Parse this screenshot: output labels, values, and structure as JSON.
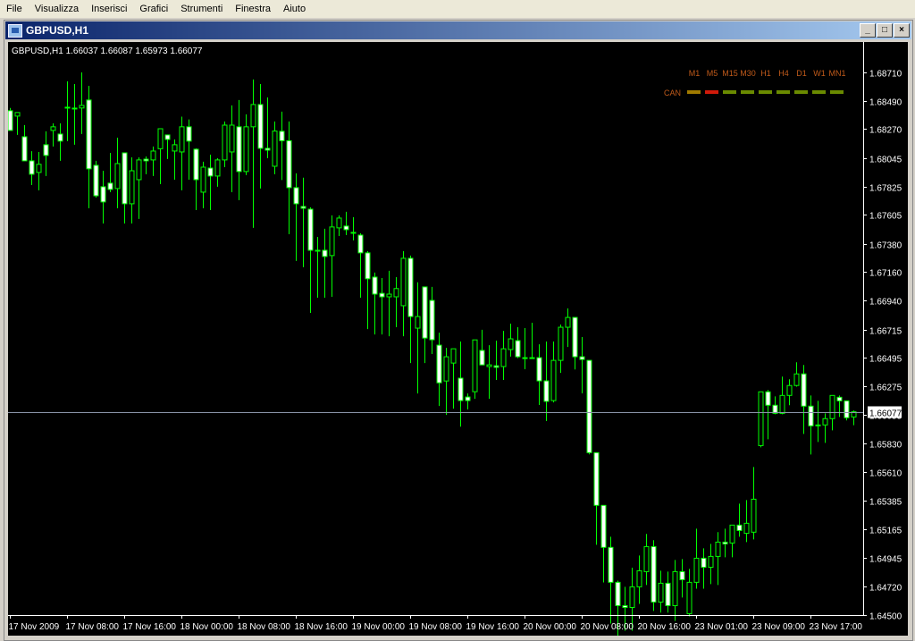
{
  "menu": [
    "File",
    "Visualizza",
    "Inserisci",
    "Grafici",
    "Strumenti",
    "Finestra",
    "Aiuto"
  ],
  "window": {
    "title": "GBPUSD,H1",
    "buttons": {
      "minimize": "_",
      "maximize": "□",
      "close": "×"
    }
  },
  "colors": {
    "background": "#000000",
    "candle_outline": "#00ff00",
    "bear_fill": "#ffffff",
    "bull_fill": "#000000",
    "axis": "#ffffff",
    "bid_line": "#8a94a8",
    "indicator_text": "#c05a1a"
  },
  "indicator": {
    "label": "CAN",
    "timeframes": [
      "M1",
      "M5",
      "M15",
      "M30",
      "H1",
      "H4",
      "D1",
      "W1",
      "MN1"
    ],
    "states": [
      {
        "tf": "M1",
        "color": "#a07a00"
      },
      {
        "tf": "M5",
        "color": "#d01a0a"
      },
      {
        "tf": "M15",
        "color": "#6a8a00"
      },
      {
        "tf": "M30",
        "color": "#6a8a00"
      },
      {
        "tf": "H1",
        "color": "#6a8a00"
      },
      {
        "tf": "H4",
        "color": "#6a8a00"
      },
      {
        "tf": "D1",
        "color": "#6a8a00"
      },
      {
        "tf": "W1",
        "color": "#6a8a00"
      },
      {
        "tf": "MN1",
        "color": "#6a8a00"
      }
    ]
  },
  "chart_data": {
    "type": "candlestick",
    "title": "GBPUSD,H1  1.66037 1.66087 1.65973 1.66077",
    "symbol": "GBPUSD",
    "timeframe": "H1",
    "last_ohlc": {
      "open": 1.66037,
      "high": 1.66087,
      "low": 1.65973,
      "close": 1.66077
    },
    "bid": 1.66077,
    "ylim": [
      1.645,
      1.6895
    ],
    "y_ticks": [
      1.6871,
      1.6849,
      1.6827,
      1.68045,
      1.67825,
      1.67605,
      1.6738,
      1.6716,
      1.6694,
      1.66715,
      1.66495,
      1.66275,
      1.66055,
      1.6583,
      1.6561,
      1.65385,
      1.65165,
      1.64945,
      1.6472,
      1.645
    ],
    "x_ticks": [
      {
        "label": "17 Nov 2009",
        "index": 0
      },
      {
        "label": "17 Nov 08:00",
        "index": 8
      },
      {
        "label": "17 Nov 16:00",
        "index": 16
      },
      {
        "label": "18 Nov 00:00",
        "index": 24
      },
      {
        "label": "18 Nov 08:00",
        "index": 32
      },
      {
        "label": "18 Nov 16:00",
        "index": 40
      },
      {
        "label": "19 Nov 00:00",
        "index": 48
      },
      {
        "label": "19 Nov 08:00",
        "index": 56
      },
      {
        "label": "19 Nov 16:00",
        "index": 64
      },
      {
        "label": "20 Nov 00:00",
        "index": 72
      },
      {
        "label": "20 Nov 08:00",
        "index": 80
      },
      {
        "label": "20 Nov 16:00",
        "index": 88
      },
      {
        "label": "23 Nov 01:00",
        "index": 96
      },
      {
        "label": "23 Nov 09:00",
        "index": 104
      },
      {
        "label": "23 Nov 17:00",
        "index": 112
      }
    ],
    "candles": [
      [
        1.68413,
        1.68434,
        1.68302,
        1.6826
      ],
      [
        1.68371,
        1.68399,
        1.68225,
        1.68399
      ],
      [
        1.68211,
        1.68302,
        1.68114,
        1.68024
      ],
      [
        1.68024,
        1.68099,
        1.67836,
        1.6792
      ],
      [
        1.67934,
        1.68093,
        1.67795,
        1.67997
      ],
      [
        1.68149,
        1.68253,
        1.67906,
        1.68066
      ],
      [
        1.6826,
        1.68315,
        1.68135,
        1.68288
      ],
      [
        1.68232,
        1.68315,
        1.68024,
        1.68177
      ],
      [
        1.6844,
        1.68641,
        1.68177,
        1.6844
      ],
      [
        1.68433,
        1.6862,
        1.68149,
        1.68426
      ],
      [
        1.68434,
        1.6871,
        1.68232,
        1.68454
      ],
      [
        1.68496,
        1.68606,
        1.67656,
        1.67962
      ],
      [
        1.67989,
        1.68024,
        1.67739,
        1.67753
      ],
      [
        1.67823,
        1.67947,
        1.67538,
        1.67705
      ],
      [
        1.67851,
        1.68086,
        1.67781,
        1.67802
      ],
      [
        1.67809,
        1.68204,
        1.67656,
        1.68003
      ],
      [
        1.68086,
        1.68086,
        1.67538,
        1.67691
      ],
      [
        1.67691,
        1.68051,
        1.67538,
        1.67947
      ],
      [
        1.67878,
        1.68051,
        1.67573,
        1.68031
      ],
      [
        1.68037,
        1.68058,
        1.6792,
        1.68024
      ],
      [
        1.68031,
        1.68135,
        1.67906,
        1.681
      ],
      [
        1.68118,
        1.68253,
        1.67843,
        1.68273
      ],
      [
        1.68225,
        1.68225,
        1.68038,
        1.6819
      ],
      [
        1.681,
        1.6819,
        1.67878,
        1.68149
      ],
      [
        1.68093,
        1.68367,
        1.67795,
        1.68288
      ],
      [
        1.68288,
        1.68345,
        1.67878,
        1.68177
      ],
      [
        1.68114,
        1.68121,
        1.67642,
        1.67878
      ],
      [
        1.67781,
        1.68017,
        1.67656,
        1.67975
      ],
      [
        1.67968,
        1.68072,
        1.67642,
        1.67906
      ],
      [
        1.67906,
        1.68044,
        1.67823,
        1.68031
      ],
      [
        1.68031,
        1.68329,
        1.67975,
        1.68301
      ],
      [
        1.68093,
        1.68454,
        1.67781,
        1.68301
      ],
      [
        1.68288,
        1.68496,
        1.67719,
        1.67941
      ],
      [
        1.67941,
        1.68385,
        1.67913,
        1.68288
      ],
      [
        1.68288,
        1.68655,
        1.67504,
        1.68461
      ],
      [
        1.68461,
        1.6862,
        1.67809,
        1.68121
      ],
      [
        1.68121,
        1.68516,
        1.68044,
        1.68107
      ],
      [
        1.67982,
        1.68329,
        1.6792,
        1.68255
      ],
      [
        1.68253,
        1.68406,
        1.67875,
        1.6818
      ],
      [
        1.6818,
        1.68329,
        1.67455,
        1.67816
      ],
      [
        1.67816,
        1.67927,
        1.67247,
        1.67691
      ],
      [
        1.6767,
        1.67893,
        1.67199,
        1.67656
      ],
      [
        1.67649,
        1.67664,
        1.66844,
        1.6733
      ],
      [
        1.6733,
        1.67434,
        1.66962,
        1.6733
      ],
      [
        1.6733,
        1.67497,
        1.66962,
        1.67282
      ],
      [
        1.67289,
        1.67601,
        1.66969,
        1.67511
      ],
      [
        1.67504,
        1.67601,
        1.67441,
        1.6758
      ],
      [
        1.67518,
        1.67629,
        1.67448,
        1.6749
      ],
      [
        1.67469,
        1.67587,
        1.67407,
        1.67462
      ],
      [
        1.67448,
        1.67462,
        1.66962,
        1.6731
      ],
      [
        1.6731,
        1.67324,
        1.66719,
        1.67109
      ],
      [
        1.67122,
        1.67157,
        1.66677,
        1.6699
      ],
      [
        1.66996,
        1.67115,
        1.66677,
        1.66969
      ],
      [
        1.66969,
        1.67171,
        1.66663,
        1.6699
      ],
      [
        1.66969,
        1.67122,
        1.66733,
        1.67033
      ],
      [
        1.669,
        1.67324,
        1.66663,
        1.67268
      ],
      [
        1.67268,
        1.67289,
        1.66455,
        1.66816
      ],
      [
        1.66726,
        1.67082,
        1.66219,
        1.66816
      ],
      [
        1.67046,
        1.67046,
        1.66455,
        1.66649
      ],
      [
        1.66941,
        1.67046,
        1.66525,
        1.66636
      ],
      [
        1.66594,
        1.66691,
        1.66122,
        1.66302
      ],
      [
        1.66316,
        1.66573,
        1.66053,
        1.66504
      ],
      [
        1.66455,
        1.66552,
        1.66101,
        1.66566
      ],
      [
        1.66338,
        1.66622,
        1.65962,
        1.66164
      ],
      [
        1.66192,
        1.66219,
        1.66095,
        1.66164
      ],
      [
        1.66233,
        1.66629,
        1.66178,
        1.66635
      ],
      [
        1.66553,
        1.66713,
        1.66441,
        1.66441
      ],
      [
        1.66428,
        1.66594,
        1.66178,
        1.66441
      ],
      [
        1.66434,
        1.66629,
        1.66324,
        1.66422
      ],
      [
        1.66428,
        1.66705,
        1.66324,
        1.66566
      ],
      [
        1.6656,
        1.66761,
        1.66505,
        1.66643
      ],
      [
        1.66629,
        1.66733,
        1.66493,
        1.66504
      ],
      [
        1.66497,
        1.66726,
        1.66407,
        1.66497
      ],
      [
        1.66497,
        1.66768,
        1.66497,
        1.66497
      ],
      [
        1.66497,
        1.66601,
        1.6613,
        1.66317
      ],
      [
        1.66317,
        1.66622,
        1.66005,
        1.66158
      ],
      [
        1.66164,
        1.66622,
        1.6615,
        1.66476
      ],
      [
        1.66476,
        1.66754,
        1.66379,
        1.66733
      ],
      [
        1.66733,
        1.66879,
        1.6658,
        1.66809
      ],
      [
        1.66809,
        1.66782,
        1.66406,
        1.66504
      ],
      [
        1.66504,
        1.66657,
        1.6622,
        1.66483
      ],
      [
        1.66476,
        1.66476,
        1.65747,
        1.6576
      ],
      [
        1.6576,
        1.6576,
        1.65045,
        1.65351
      ],
      [
        1.65351,
        1.65351,
        1.64753,
        1.65025
      ],
      [
        1.65025,
        1.65108,
        1.64434,
        1.64754
      ],
      [
        1.64754,
        1.64767,
        1.64309,
        1.64573
      ],
      [
        1.64573,
        1.64719,
        1.64379,
        1.64559
      ],
      [
        1.64559,
        1.64868,
        1.64379,
        1.64719
      ],
      [
        1.64719,
        1.64962,
        1.64587,
        1.64844
      ],
      [
        1.64837,
        1.65129,
        1.64733,
        1.65031
      ],
      [
        1.65031,
        1.65081,
        1.64532,
        1.64601
      ],
      [
        1.64601,
        1.64844,
        1.64519,
        1.64747
      ],
      [
        1.64747,
        1.64837,
        1.64519,
        1.64573
      ],
      [
        1.64573,
        1.64927,
        1.64455,
        1.64837
      ],
      [
        1.64837,
        1.64934,
        1.64636,
        1.64774
      ],
      [
        1.64511,
        1.64858,
        1.6449,
        1.64754
      ],
      [
        1.64754,
        1.6517,
        1.64705,
        1.64941
      ],
      [
        1.64941,
        1.65018,
        1.64705,
        1.64871
      ],
      [
        1.64871,
        1.65052,
        1.6474,
        1.64955
      ],
      [
        1.64955,
        1.65143,
        1.64733,
        1.65066
      ],
      [
        1.65066,
        1.6517,
        1.64948,
        1.65052
      ],
      [
        1.65059,
        1.6517,
        1.64948,
        1.65198
      ],
      [
        1.65198,
        1.65364,
        1.65108,
        1.65156
      ],
      [
        1.65134,
        1.65392,
        1.65066,
        1.65212
      ],
      [
        1.65143,
        1.65649,
        1.65087,
        1.65399
      ],
      [
        1.65815,
        1.66065,
        1.65801,
        1.66232
      ],
      [
        1.66232,
        1.66246,
        1.65864,
        1.66128
      ],
      [
        1.66128,
        1.66197,
        1.66058,
        1.66065
      ],
      [
        1.66065,
        1.6635,
        1.66058,
        1.66204
      ],
      [
        1.66204,
        1.66329,
        1.66128,
        1.66281
      ],
      [
        1.66281,
        1.66461,
        1.66272,
        1.66371
      ],
      [
        1.66371,
        1.6644,
        1.65905,
        1.66121
      ],
      [
        1.66121,
        1.66204,
        1.65746,
        1.65968
      ],
      [
        1.65968,
        1.66162,
        1.65843,
        1.65975
      ],
      [
        1.65975,
        1.66065,
        1.65836,
        1.66024
      ],
      [
        1.66024,
        1.66204,
        1.65933,
        1.66204
      ],
      [
        1.6619,
        1.66204,
        1.66037,
        1.66162
      ],
      [
        1.66162,
        1.66148,
        1.6601,
        1.66031
      ],
      [
        1.66037,
        1.66087,
        1.65973,
        1.66077
      ]
    ]
  }
}
